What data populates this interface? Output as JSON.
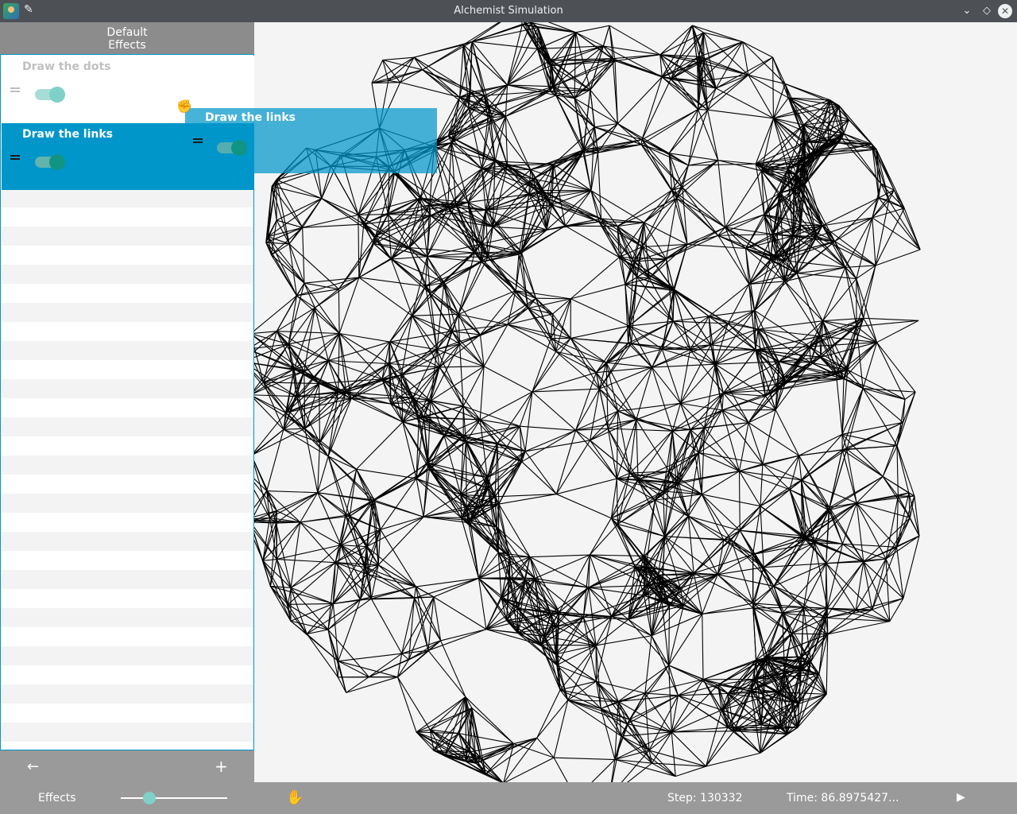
{
  "window": {
    "title": "Alchemist Simulation",
    "controls": {
      "minimize_icon": "chevron-down-icon",
      "maximize_icon": "diamond-icon",
      "close_icon": "close-icon"
    }
  },
  "panel": {
    "header": {
      "line1": "Default",
      "line2": "Effects"
    },
    "effects": [
      {
        "name": "Draw the dots",
        "enabled": true,
        "selected": false
      },
      {
        "name": "Draw the links",
        "enabled": true,
        "selected": true
      }
    ],
    "drag_preview": {
      "name": "Draw the links"
    },
    "footer": {
      "back_icon": "arrow-left-icon",
      "add_icon": "plus-icon"
    }
  },
  "bottombar": {
    "effects_label": "Effects",
    "zoom_level": 0.27,
    "pan_icon": "hand-icon",
    "step": "Step: 130332",
    "time": "Time: 86.8975427...",
    "play_icon": "play-icon"
  },
  "colors": {
    "accent": "#0096c9",
    "toggle_on": "#109585",
    "titlebar": "#4d5156",
    "panel": "#9a9a9a"
  }
}
